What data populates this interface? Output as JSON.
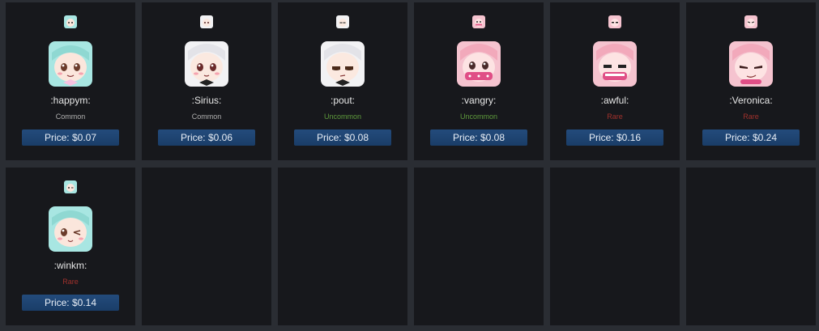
{
  "items": [
    {
      "name": ":happym:",
      "rarity": "Common",
      "price": "Price: $0.07",
      "hair": "#a8e6e2",
      "face": "winkless"
    },
    {
      "name": ":Sirius:",
      "rarity": "Common",
      "price": "Price: $0.06",
      "hair": "#f2f2f4",
      "face": "plain"
    },
    {
      "name": ":pout:",
      "rarity": "Uncommon",
      "price": "Price: $0.08",
      "hair": "#f2f2f4",
      "face": "pout"
    },
    {
      "name": ":vangry:",
      "rarity": "Uncommon",
      "price": "Price: $0.08",
      "hair": "#f5c3cf",
      "face": "angry"
    },
    {
      "name": ":awful:",
      "rarity": "Rare",
      "price": "Price: $0.16",
      "hair": "#f5c3cf",
      "face": "awful"
    },
    {
      "name": ":Veronica:",
      "rarity": "Rare",
      "price": "Price: $0.24",
      "hair": "#f5c3cf",
      "face": "smug"
    },
    {
      "name": ":winkm:",
      "rarity": "Rare",
      "price": "Price: $0.14",
      "hair": "#a8e6e2",
      "face": "wink"
    }
  ],
  "colors": {
    "common": "#b0b0b0",
    "uncommon": "#5e9a3c",
    "rare": "#a0312c",
    "price_button": "#1d4270",
    "card_bg": "#17181c"
  }
}
